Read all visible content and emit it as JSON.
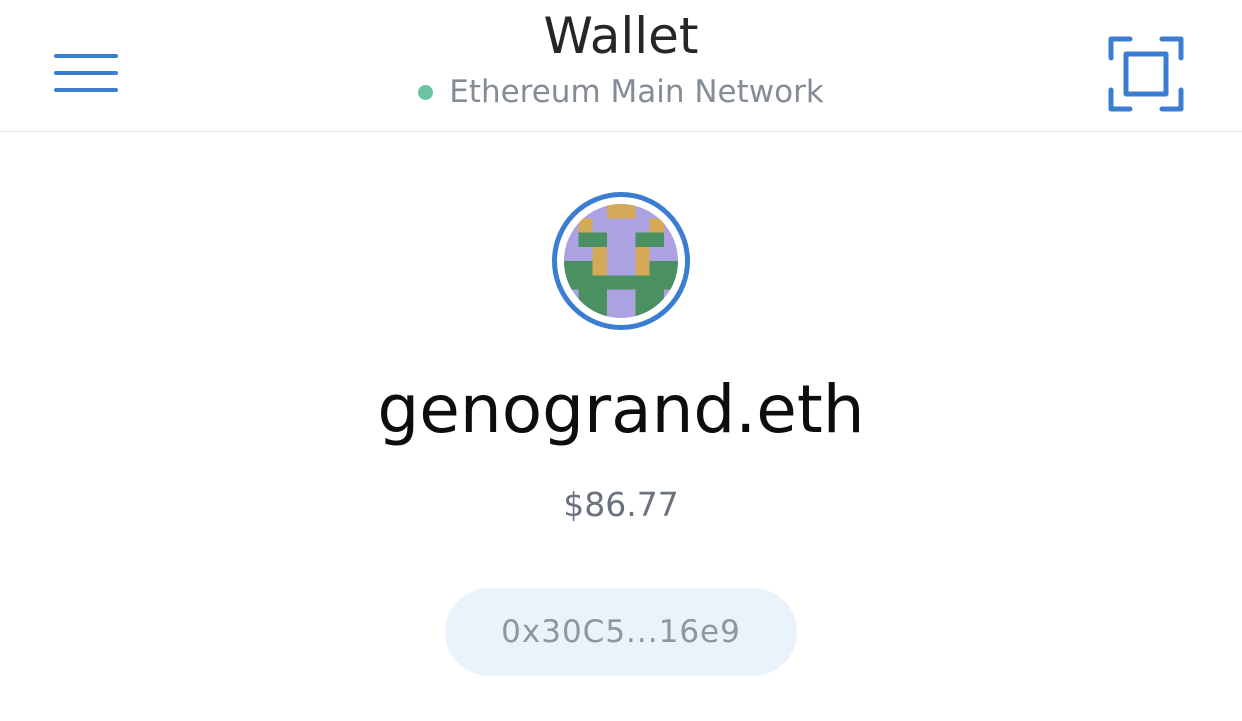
{
  "header": {
    "title": "Wallet",
    "network_name": "Ethereum Main Network",
    "network_status_color": "#6cc59f",
    "menu_icon": "hamburger-menu-icon",
    "scan_icon": "qr-scan-icon"
  },
  "account": {
    "name": "genogrand.eth",
    "balance": "$86.77",
    "address_short": "0x30C5...16e9",
    "avatar_icon": "identicon-avatar"
  },
  "colors": {
    "accent": "#3b7dd0",
    "identicon_purple": "#aca2e2",
    "identicon_green": "#4a9060",
    "identicon_gold": "#d4a958"
  }
}
